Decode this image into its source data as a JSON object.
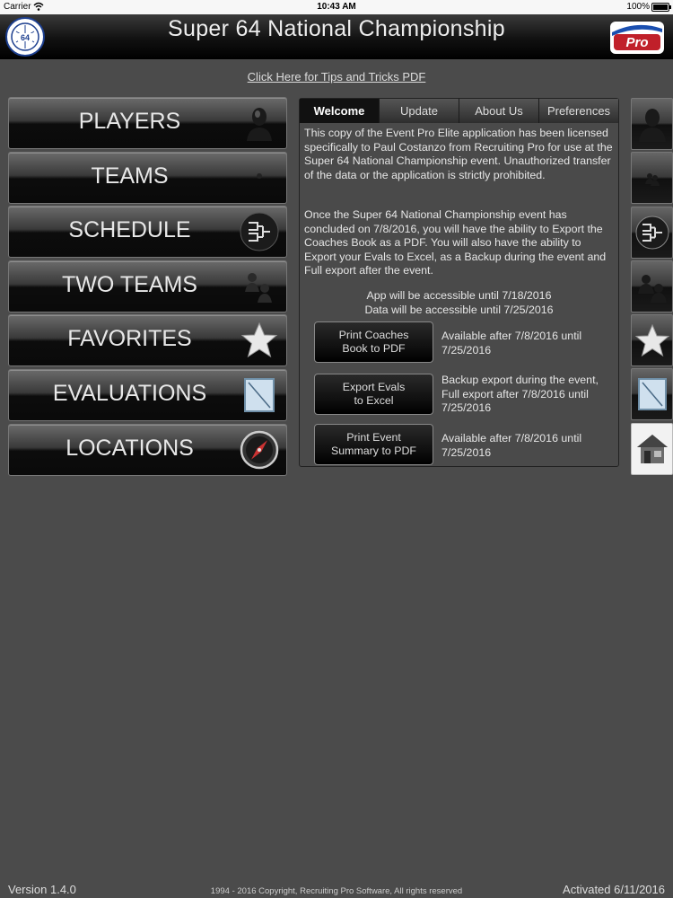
{
  "status_bar": {
    "carrier": "Carrier",
    "time": "10:43 AM",
    "battery": "100%"
  },
  "header": {
    "title": "Super 64 National Championship",
    "left_logo_icon": "super64-seal-icon",
    "right_logo_text": "Pro",
    "right_logo_icon": "recruiting-pro-logo-icon"
  },
  "tips_link": "Click Here for Tips and Tricks PDF",
  "menu": [
    {
      "label": "PLAYERS",
      "icon": "player-silhouette-icon"
    },
    {
      "label": "TEAMS",
      "icon": "team-icon"
    },
    {
      "label": "SCHEDULE",
      "icon": "bracket-icon"
    },
    {
      "label": "TWO TEAMS",
      "icon": "two-teams-icon"
    },
    {
      "label": "FAVORITES",
      "icon": "star-icon"
    },
    {
      "label": "EVALUATIONS",
      "icon": "notebook-icon"
    },
    {
      "label": "LOCATIONS",
      "icon": "compass-icon"
    }
  ],
  "tabs": [
    {
      "label": "Welcome",
      "active": true
    },
    {
      "label": "Update",
      "active": false
    },
    {
      "label": "About Us",
      "active": false
    },
    {
      "label": "Preferences",
      "active": false
    }
  ],
  "welcome": {
    "paragraph1": "This copy of the Event Pro Elite application has been licensed specifically to Paul Costanzo from Recruiting Pro for use at the Super 64 National Championship event. Unauthorized transfer of the data or the application is strictly prohibited.",
    "paragraph2": "Once the Super 64 National Championship event has concluded on 7/8/2016, you will have the ability to Export the Coaches Book as a PDF.  You will also have the ability to Export your Evals to Excel, as a Backup during the event and Full export after the event.",
    "app_access": "App will be accessible until 7/18/2016",
    "data_access": "Data will be accessible until 7/25/2016",
    "actions": [
      {
        "line1": "Print Coaches",
        "line2": "Book to PDF",
        "desc": "Available after 7/8/2016 until 7/25/2016"
      },
      {
        "line1": "Export Evals",
        "line2": "to Excel",
        "desc": "Backup export during the event, Full export after 7/8/2016 until 7/25/2016"
      },
      {
        "line1": "Print Event",
        "line2": "Summary to PDF",
        "desc": "Available after 7/8/2016 until 7/25/2016"
      }
    ]
  },
  "sidebar_icons": [
    "player-icon",
    "team-icon",
    "bracket-icon",
    "two-teams-icon",
    "star-icon",
    "notebook-icon",
    "home-icon"
  ],
  "footer": {
    "version": "Version 1.4.0",
    "copyright": "1994 - 2016 Copyright, Recruiting Pro Software, All rights reserved",
    "activated": "Activated 6/11/2016"
  },
  "colors": {
    "background": "#4b4b4b",
    "header": "#000000",
    "active_sidebar": "#f2f2f2"
  }
}
